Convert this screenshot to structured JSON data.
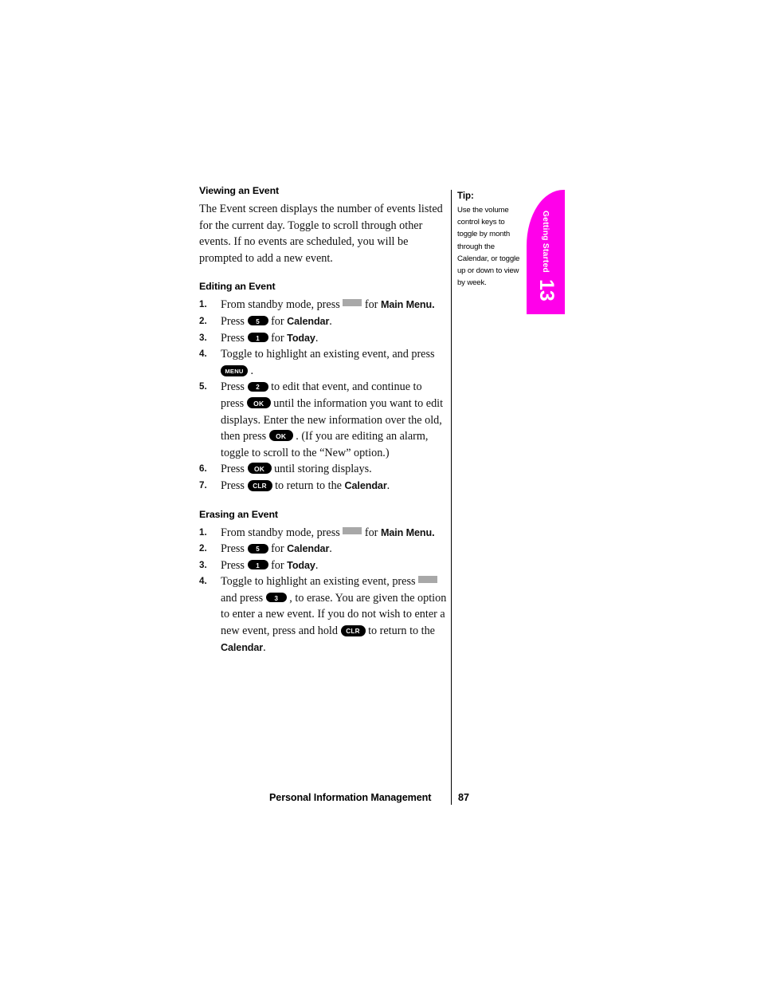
{
  "page": {
    "footer_title": "Personal Information Management",
    "footer_page_number": "87"
  },
  "thumb_tab": {
    "label": "Getting Started",
    "chapter_number": "13",
    "color": "#ff00ea"
  },
  "tip": {
    "label": "Tip:",
    "body": "Use the volume control keys to toggle by month through the Calendar, or toggle up or down to view by week."
  },
  "keys": {
    "soft": "",
    "one": "1",
    "two": "2",
    "three": "3",
    "five": "5",
    "ok": "OK",
    "clr": "CLR",
    "menu": "MENU"
  },
  "sections": {
    "viewing": {
      "heading": "Viewing an Event",
      "paragraph": "The Event screen displays the number of events listed for the current day. Toggle to scroll through other events. If no events are scheduled, you will be prompted to add a new event."
    },
    "editing": {
      "heading": "Editing an Event",
      "steps": [
        {
          "num": "1.",
          "t1": "From standby mode, press",
          "t2": "for",
          "bold1": "Main Menu."
        },
        {
          "num": "2.",
          "t1": "Press",
          "t2": "for",
          "bold1": "Calendar",
          "t3": "."
        },
        {
          "num": "3.",
          "t1": "Press",
          "t2": "for",
          "bold1": "Today",
          "t3": "."
        },
        {
          "num": "4.",
          "t1": "Toggle to highlight an existing event, and press",
          "t2": "."
        },
        {
          "num": "5.",
          "t1": "Press",
          "t2": "to edit that event, and continue to press",
          "t3": "until the information you want to edit displays. Enter the new information over the old, then press",
          "t4": ". (If you are editing an alarm, toggle to scroll to the “New” option.)"
        },
        {
          "num": "6.",
          "t1": "Press",
          "t2": "until storing displays."
        },
        {
          "num": "7.",
          "t1": "Press",
          "t2": "to return to the",
          "bold1": "Calendar",
          "t3": "."
        }
      ]
    },
    "erasing": {
      "heading": "Erasing an Event",
      "steps": [
        {
          "num": "1.",
          "t1": "From standby mode, press",
          "t2": "for",
          "bold1": "Main Menu."
        },
        {
          "num": "2.",
          "t1": "Press",
          "t2": "for",
          "bold1": "Calendar",
          "t3": "."
        },
        {
          "num": "3.",
          "t1": "Press",
          "t2": "for",
          "bold1": "Today",
          "t3": "."
        },
        {
          "num": "4.",
          "t1": "Toggle to highlight an existing event, press",
          "t2": "and press",
          "t3": ", to erase. You are given the option to enter a new event. If you do not wish to enter a new event, press and hold",
          "t4": "to return to the",
          "bold1": "Calendar",
          "t5": "."
        }
      ]
    }
  }
}
